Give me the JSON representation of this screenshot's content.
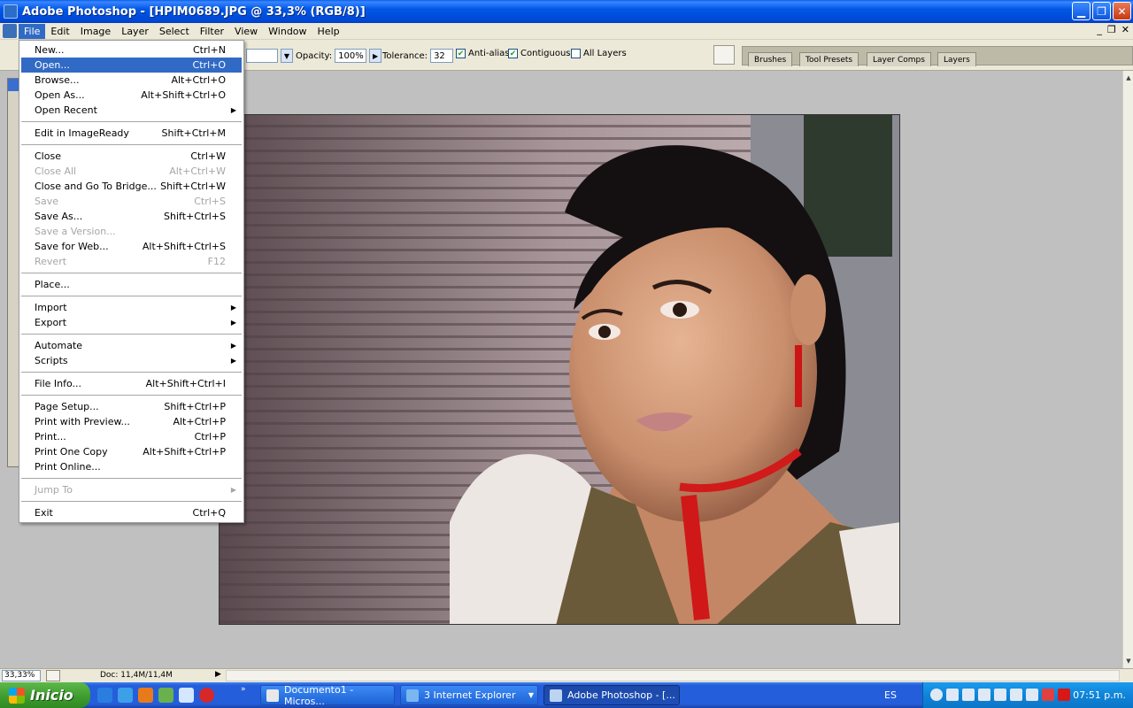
{
  "window": {
    "title": "Adobe Photoshop - [HPIM0689.JPG @ 33,3% (RGB/8)]"
  },
  "menubar": {
    "items": [
      "File",
      "Edit",
      "Image",
      "Layer",
      "Select",
      "Filter",
      "View",
      "Window",
      "Help"
    ],
    "doc_buttons": [
      "_",
      "❐",
      "✕"
    ]
  },
  "options": {
    "opacity_label": "Opacity:",
    "opacity_value": "100%",
    "tolerance_label": "Tolerance:",
    "tolerance_value": "32",
    "antialias_label": "Anti-alias",
    "contiguous_label": "Contiguous",
    "all_layers_label": "All Layers"
  },
  "palette_tabs": [
    "Brushes",
    "Tool Presets",
    "Layer Comps",
    "Layers"
  ],
  "file_menu": [
    {
      "label": "New...",
      "shortcut": "Ctrl+N"
    },
    {
      "label": "Open...",
      "shortcut": "Ctrl+O",
      "highlight": true
    },
    {
      "label": "Browse...",
      "shortcut": "Alt+Ctrl+O"
    },
    {
      "label": "Open As...",
      "shortcut": "Alt+Shift+Ctrl+O"
    },
    {
      "label": "Open Recent",
      "shortcut": "",
      "submenu": true
    },
    {
      "sep": true
    },
    {
      "label": "Edit in ImageReady",
      "shortcut": "Shift+Ctrl+M"
    },
    {
      "sep": true
    },
    {
      "label": "Close",
      "shortcut": "Ctrl+W"
    },
    {
      "label": "Close All",
      "shortcut": "Alt+Ctrl+W",
      "disabled": true
    },
    {
      "label": "Close and Go To Bridge...",
      "shortcut": "Shift+Ctrl+W"
    },
    {
      "label": "Save",
      "shortcut": "Ctrl+S",
      "disabled": true
    },
    {
      "label": "Save As...",
      "shortcut": "Shift+Ctrl+S"
    },
    {
      "label": "Save a Version...",
      "shortcut": "",
      "disabled": true
    },
    {
      "label": "Save for Web...",
      "shortcut": "Alt+Shift+Ctrl+S"
    },
    {
      "label": "Revert",
      "shortcut": "F12",
      "disabled": true
    },
    {
      "sep": true
    },
    {
      "label": "Place...",
      "shortcut": ""
    },
    {
      "sep": true
    },
    {
      "label": "Import",
      "shortcut": "",
      "submenu": true
    },
    {
      "label": "Export",
      "shortcut": "",
      "submenu": true
    },
    {
      "sep": true
    },
    {
      "label": "Automate",
      "shortcut": "",
      "submenu": true
    },
    {
      "label": "Scripts",
      "shortcut": "",
      "submenu": true
    },
    {
      "sep": true
    },
    {
      "label": "File Info...",
      "shortcut": "Alt+Shift+Ctrl+I"
    },
    {
      "sep": true
    },
    {
      "label": "Page Setup...",
      "shortcut": "Shift+Ctrl+P"
    },
    {
      "label": "Print with Preview...",
      "shortcut": "Alt+Ctrl+P"
    },
    {
      "label": "Print...",
      "shortcut": "Ctrl+P"
    },
    {
      "label": "Print One Copy",
      "shortcut": "Alt+Shift+Ctrl+P"
    },
    {
      "label": "Print Online...",
      "shortcut": ""
    },
    {
      "sep": true
    },
    {
      "label": "Jump To",
      "shortcut": "",
      "submenu": true,
      "disabled": true
    },
    {
      "sep": true
    },
    {
      "label": "Exit",
      "shortcut": "Ctrl+Q"
    }
  ],
  "status": {
    "zoom": "33,33%",
    "doc": "Doc: 11,4M/11,4M"
  },
  "taskbar": {
    "start_label": "Inicio",
    "tasks": [
      {
        "label": "Documento1 - Micros...",
        "active": false
      },
      {
        "label": "3 Internet Explorer",
        "active": false
      },
      {
        "label": "Adobe Photoshop - [...",
        "active": true
      }
    ],
    "lang": "ES",
    "clock": "07:51 p.m."
  },
  "colors": {
    "menu_highlight": "#316ac5",
    "titlebar": "#0058e6",
    "taskbar": "#245edb"
  }
}
